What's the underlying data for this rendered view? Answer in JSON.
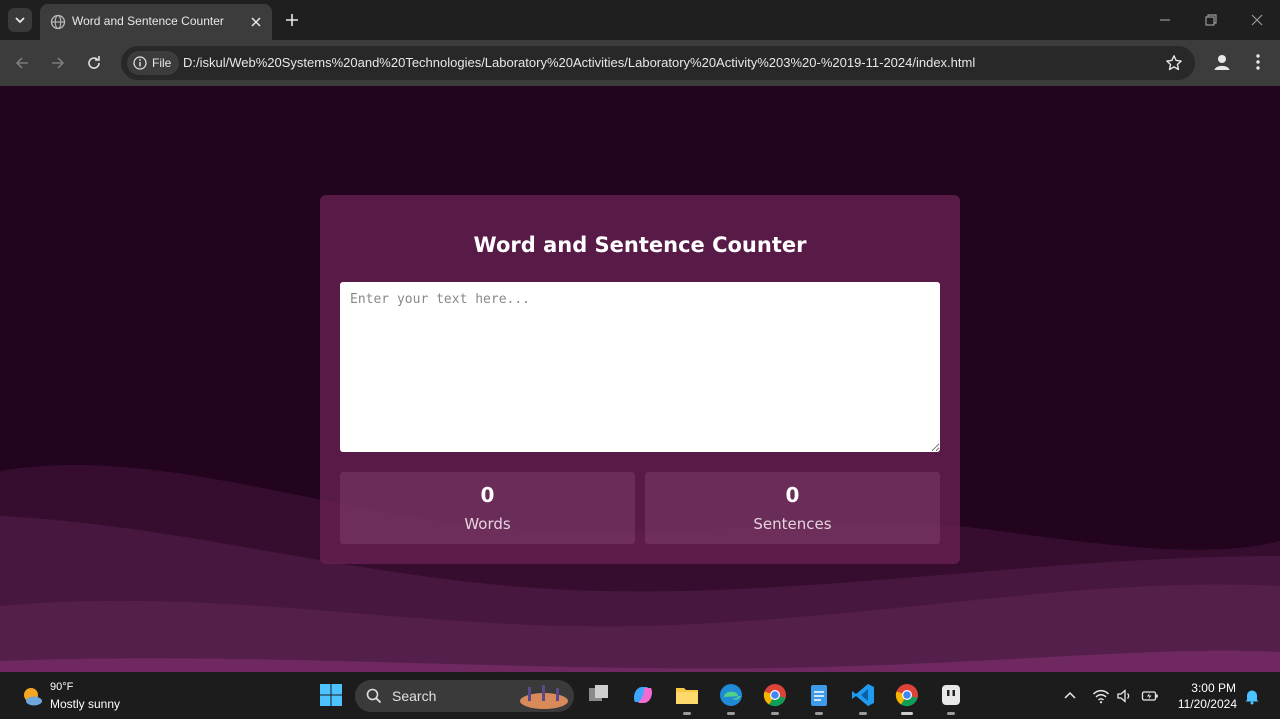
{
  "browser": {
    "tab_title": "Word and Sentence Counter",
    "chip_label": "File",
    "url": "D:/iskul/Web%20Systems%20and%20Technologies/Laboratory%20Activities/Laboratory%20Activity%203%20-%2019-11-2024/index.html"
  },
  "page": {
    "title": "Word and Sentence Counter",
    "textarea_placeholder": "Enter your text here...",
    "textarea_value": "",
    "stats": [
      {
        "value": "0",
        "label": "Words"
      },
      {
        "value": "0",
        "label": "Sentences"
      }
    ]
  },
  "taskbar": {
    "weather_temp": "90°F",
    "weather_desc": "Mostly sunny",
    "search_label": "Search",
    "apps": [
      "start-icon",
      "task-view-icon",
      "copilot-icon",
      "file-explorer-icon",
      "edge-icon",
      "chrome-icon",
      "notepad-icon",
      "vscode-icon",
      "chrome-icon",
      "app-icon"
    ],
    "time": "3:00 PM",
    "date": "11/20/2024"
  },
  "colors": {
    "page_bg": "#22041e",
    "card_bg": "#6e2258",
    "tabbar_bg": "#1f1f1f",
    "toolbar_bg": "#3c3c3c"
  }
}
